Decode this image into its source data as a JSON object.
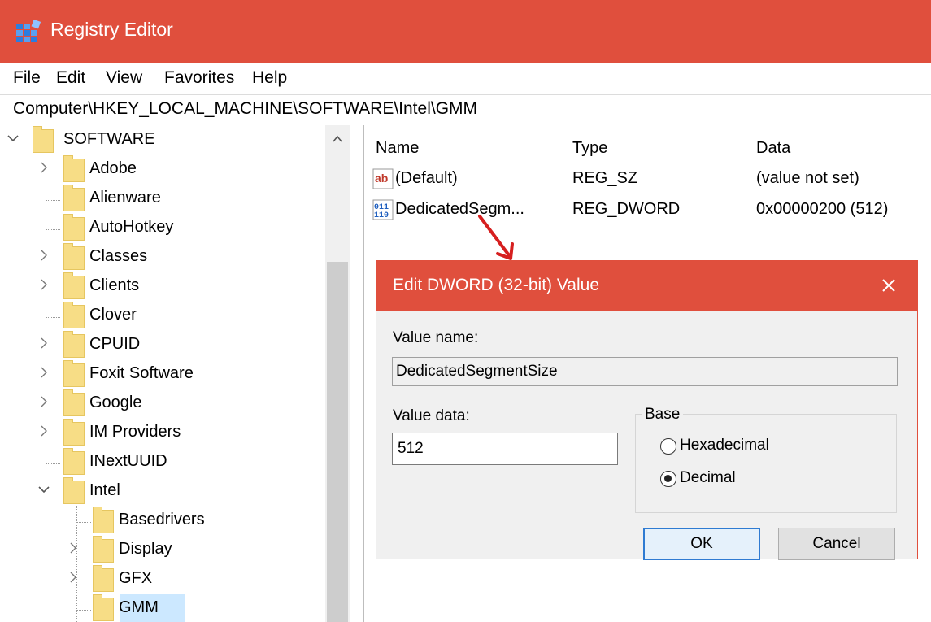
{
  "window": {
    "title": "Registry Editor"
  },
  "menu": [
    "File",
    "Edit",
    "View",
    "Favorites",
    "Help"
  ],
  "address": "Computer\\HKEY_LOCAL_MACHINE\\SOFTWARE\\Intel\\GMM",
  "tree": {
    "items": [
      {
        "label": "SOFTWARE",
        "level": 0,
        "expander": "expanded"
      },
      {
        "label": "Adobe",
        "level": 1,
        "expander": "collapsed"
      },
      {
        "label": "Alienware",
        "level": 1,
        "expander": "none"
      },
      {
        "label": "AutoHotkey",
        "level": 1,
        "expander": "none"
      },
      {
        "label": "Classes",
        "level": 1,
        "expander": "collapsed"
      },
      {
        "label": "Clients",
        "level": 1,
        "expander": "collapsed"
      },
      {
        "label": "Clover",
        "level": 1,
        "expander": "none"
      },
      {
        "label": "CPUID",
        "level": 1,
        "expander": "collapsed"
      },
      {
        "label": "Foxit Software",
        "level": 1,
        "expander": "collapsed"
      },
      {
        "label": "Google",
        "level": 1,
        "expander": "collapsed"
      },
      {
        "label": "IM Providers",
        "level": 1,
        "expander": "collapsed"
      },
      {
        "label": "INextUUID",
        "level": 1,
        "expander": "none"
      },
      {
        "label": "Intel",
        "level": 1,
        "expander": "expanded"
      },
      {
        "label": "Basedrivers",
        "level": 2,
        "expander": "none"
      },
      {
        "label": "Display",
        "level": 2,
        "expander": "collapsed"
      },
      {
        "label": "GFX",
        "level": 2,
        "expander": "collapsed"
      },
      {
        "label": "GMM",
        "level": 2,
        "expander": "none",
        "selected": true
      }
    ]
  },
  "list": {
    "columns": [
      "Name",
      "Type",
      "Data"
    ],
    "rows": [
      {
        "icon": "string-value-icon",
        "name": "(Default)",
        "type": "REG_SZ",
        "data": "(value not set)"
      },
      {
        "icon": "binary-value-icon",
        "name": "DedicatedSegm...",
        "type": "REG_DWORD",
        "data": "0x00000200 (512)"
      }
    ]
  },
  "dialog": {
    "title": "Edit DWORD (32-bit) Value",
    "value_name_label": "Value name:",
    "value_name": "DedicatedSegmentSize",
    "value_data_label": "Value data:",
    "value_data": "512",
    "base_label": "Base",
    "base_options": [
      {
        "label": "Hexadecimal",
        "checked": false
      },
      {
        "label": "Decimal",
        "checked": true
      }
    ],
    "ok_label": "OK",
    "cancel_label": "Cancel"
  },
  "colors": {
    "accent": "#e04f3d",
    "folder": "#f7dd86",
    "selection": "#cce8ff",
    "annotation_arrow": "#d61f1f"
  }
}
